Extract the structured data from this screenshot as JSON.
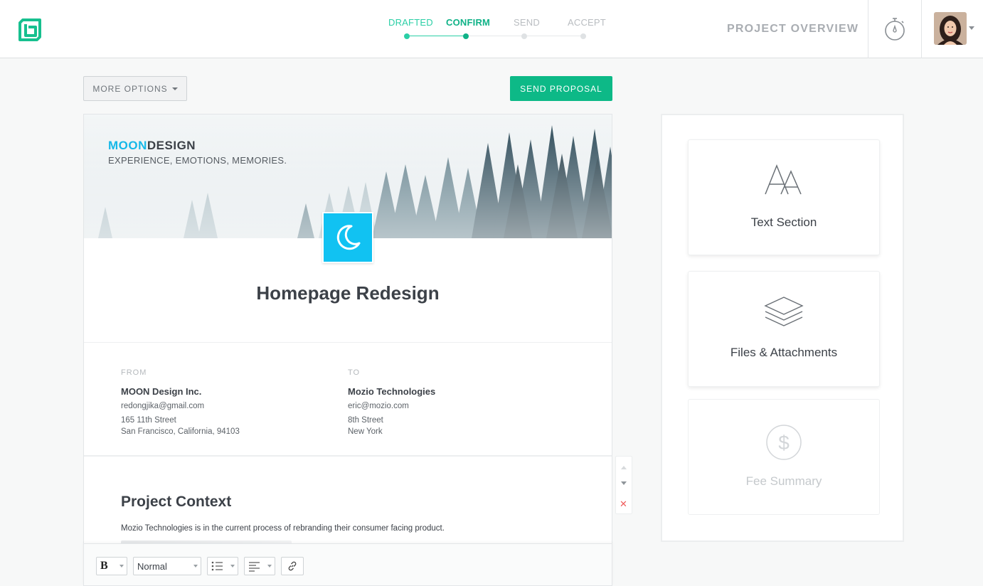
{
  "header": {
    "steps": [
      {
        "label": "DRAFTED",
        "state": "done"
      },
      {
        "label": "CONFIRM",
        "state": "active"
      },
      {
        "label": "SEND",
        "state": "todo"
      },
      {
        "label": "ACCEPT",
        "state": "todo"
      }
    ],
    "project_overview": "PROJECT OVERVIEW"
  },
  "actions": {
    "more_options": "MORE OPTIONS",
    "send_proposal": "SEND PROPOSAL"
  },
  "document": {
    "brand_primary": "MOON",
    "brand_secondary": "DESIGN",
    "tagline": "EXPERIENCE, EMOTIONS, MEMORIES.",
    "title": "Homepage Redesign",
    "from": {
      "label": "FROM",
      "name": "MOON Design Inc.",
      "email": "redongjika@gmail.com",
      "street": "165 11th Street",
      "city": "San Francisco, California, 94103"
    },
    "to": {
      "label": "TO",
      "name": "Mozio Technologies",
      "email": "eric@mozio.com",
      "street": "8th Street",
      "city": "New York"
    },
    "section": {
      "title": "Project Context",
      "body": "Mozio Technologies is in the current process of rebranding their consumer facing product."
    }
  },
  "toolbar": {
    "bold": "B",
    "style": "Normal",
    "icons": [
      "bold-icon",
      "list-icon",
      "align-left-icon",
      "link-icon"
    ]
  },
  "panel": {
    "cards": [
      {
        "label": "Text Section",
        "icon": "text-section-icon",
        "enabled": true
      },
      {
        "label": "Files & Attachments",
        "icon": "layers-icon",
        "enabled": true
      },
      {
        "label": "Fee Summary",
        "icon": "dollar-icon",
        "enabled": false
      }
    ]
  },
  "colors": {
    "accent": "#0db987",
    "brand_blue": "#16b8e8",
    "step_done": "#2bcfa6",
    "delete": "#ef5b5b"
  }
}
